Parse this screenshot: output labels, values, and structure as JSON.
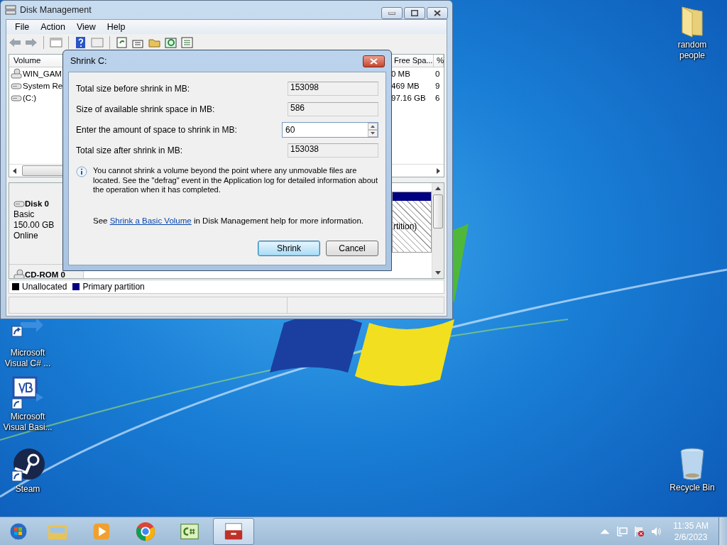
{
  "desktop_icons": [
    {
      "label": "random people",
      "kind": "folder"
    },
    {
      "label": "Microsoft Visual C# ...",
      "kind": "csharp"
    },
    {
      "label": "Microsoft Visual Basi...",
      "kind": "vb"
    },
    {
      "label": "Steam",
      "kind": "steam"
    },
    {
      "label": "Recycle Bin",
      "kind": "recycle"
    }
  ],
  "window": {
    "title": "Disk Management",
    "menu": [
      "File",
      "Action",
      "View",
      "Help"
    ],
    "volume_list": {
      "columns": [
        "Volume",
        "Free Spa...",
        "%"
      ],
      "rows": [
        {
          "volume": "WIN_GAM",
          "free_space": "0 MB",
          "percent": "0",
          "kind": "cdrom"
        },
        {
          "volume": "System Re",
          "free_space": "469 MB",
          "percent": "9",
          "kind": "disk"
        },
        {
          "volume": "(C:)",
          "free_space": "97.16 GB",
          "percent": "6",
          "kind": "disk"
        }
      ]
    },
    "disks": [
      {
        "name": "Disk 0",
        "kind": "disk",
        "details": [
          "Basic",
          "150.00 GB",
          "Online"
        ],
        "partition_label": "rtition)"
      },
      {
        "name": "CD-ROM 0",
        "kind": "cdrom"
      }
    ],
    "legend": [
      {
        "label": "Unallocated",
        "color": "#000000"
      },
      {
        "label": "Primary partition",
        "color": "#000080"
      }
    ]
  },
  "dialog": {
    "title": "Shrink C:",
    "fields": [
      {
        "label": "Total size before shrink in MB:",
        "value": "153098",
        "kind": "readonly"
      },
      {
        "label": "Size of available shrink space in MB:",
        "value": "586",
        "kind": "readonly"
      },
      {
        "label": "Enter the amount of space to shrink in MB:",
        "value": "60",
        "kind": "spin"
      },
      {
        "label": "Total size after shrink in MB:",
        "value": "153038",
        "kind": "readonly"
      }
    ],
    "info": "You cannot shrink a volume beyond the point where any unmovable files are located. See the \"defrag\" event in the Application log for detailed information about the operation when it has completed.",
    "help": {
      "before": "See",
      "link": "Shrink a Basic Volume",
      "after": "in Disk Management help for more information."
    },
    "buttons": [
      {
        "label": "Shrink",
        "default": true
      },
      {
        "label": "Cancel",
        "default": false
      }
    ]
  },
  "taskbar": {
    "apps": [
      {
        "kind": "explorer",
        "selected": false
      },
      {
        "kind": "media",
        "selected": false
      },
      {
        "kind": "chrome",
        "selected": false
      },
      {
        "kind": "csharp",
        "selected": false
      },
      {
        "kind": "diskmgmt",
        "selected": true
      }
    ],
    "clock": {
      "time": "11:35 AM",
      "date": "2/6/2023"
    }
  }
}
